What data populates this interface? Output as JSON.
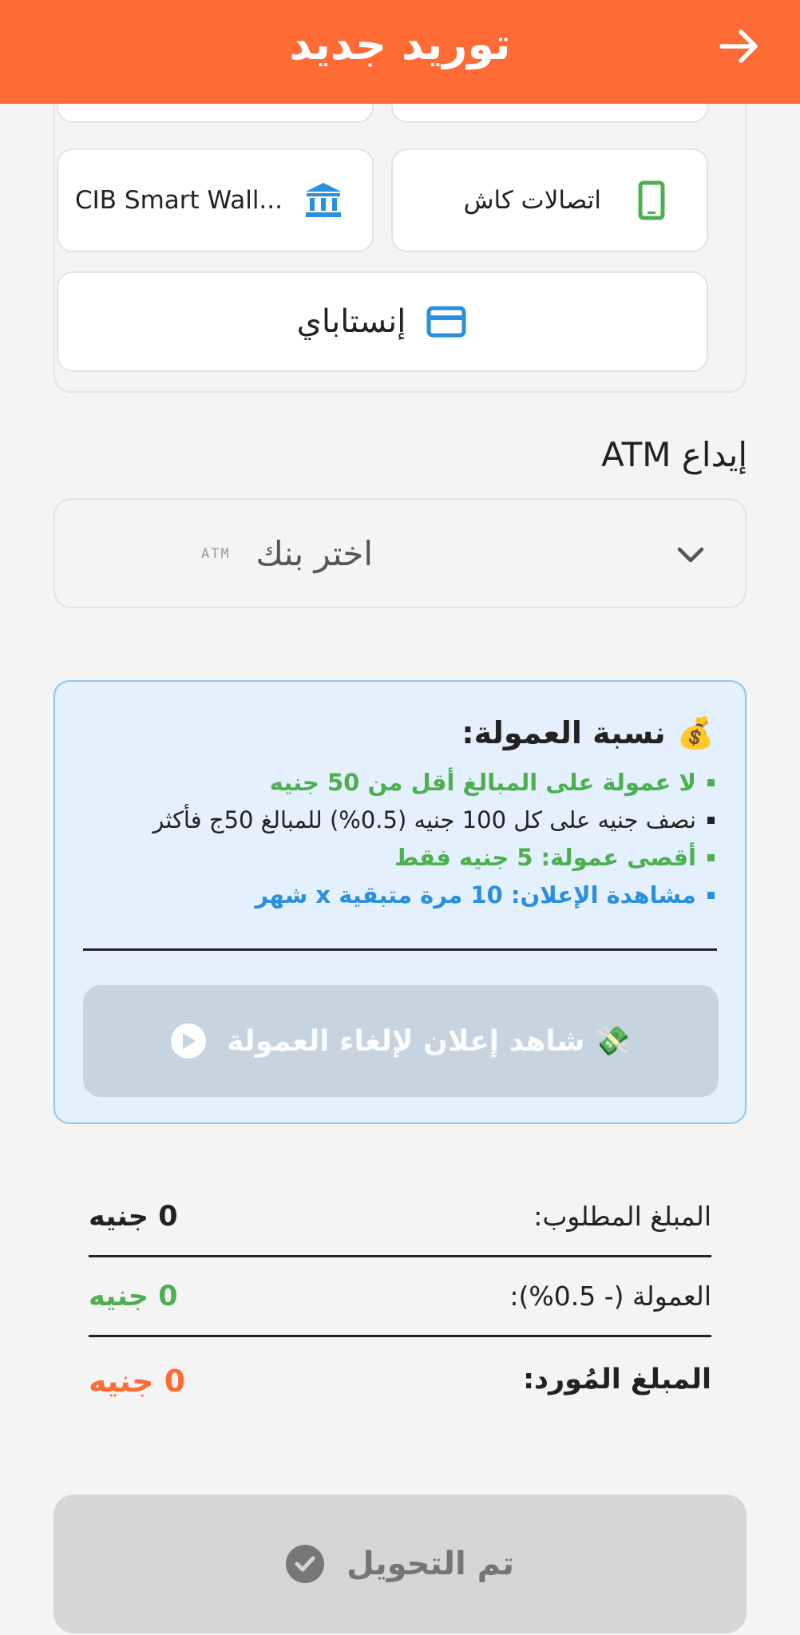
{
  "header": {
    "title": "توريد جديد",
    "back_icon": "arrow-right-icon",
    "color": "#ff6b35"
  },
  "methods": {
    "items": [
      {
        "label": "اتصالات كاش",
        "icon": "mobile-phone-icon",
        "icon_color": "#4caf50"
      },
      {
        "label": "CIB Smart Wall...",
        "icon": "bank-icon",
        "icon_color": "#2a8fdc"
      },
      {
        "label": "إنستاباي",
        "icon": "credit-card-icon",
        "icon_color": "#2a8fdc"
      }
    ]
  },
  "atm": {
    "title": "إيداع ATM",
    "placeholder": "اختر بنك",
    "mini_label": "ATM",
    "chevron_icon": "chevron-down-icon"
  },
  "commission": {
    "title": "نسبة العمولة:",
    "title_emoji": "💰",
    "bullets": [
      {
        "text": "لا عمولة على المبالغ أقل من 50 جنيه",
        "color": "#4caf50"
      },
      {
        "text": "نصف جنيه على كل 100 جنيه (0.5%) للمبالغ 50ج فأكثر",
        "color": "#222222"
      },
      {
        "text": "أقصى عمولة: 5 جنيه فقط",
        "color": "#4caf50"
      },
      {
        "text": "مشاهدة الإعلان: 10 مرة متبقية x شهر",
        "color": "#2a8fdc"
      }
    ],
    "ad_button": {
      "label": "شاهد إعلان لإلغاء العمولة",
      "emoji": "💸",
      "icon": "play-circle-icon"
    }
  },
  "summary": {
    "rows": [
      {
        "label": "المبلغ المطلوب:",
        "value": "0 جنيه",
        "value_color": "#222222"
      },
      {
        "label": "العمولة (- 0.5%):",
        "value": "0 جنيه",
        "value_color": "#4caf50"
      },
      {
        "label": "المبلغ المُورد:",
        "value": "0 جنيه",
        "value_color": "#ff6b35"
      }
    ]
  },
  "submit": {
    "label": "تم التحويل",
    "icon": "check-circle-icon"
  }
}
